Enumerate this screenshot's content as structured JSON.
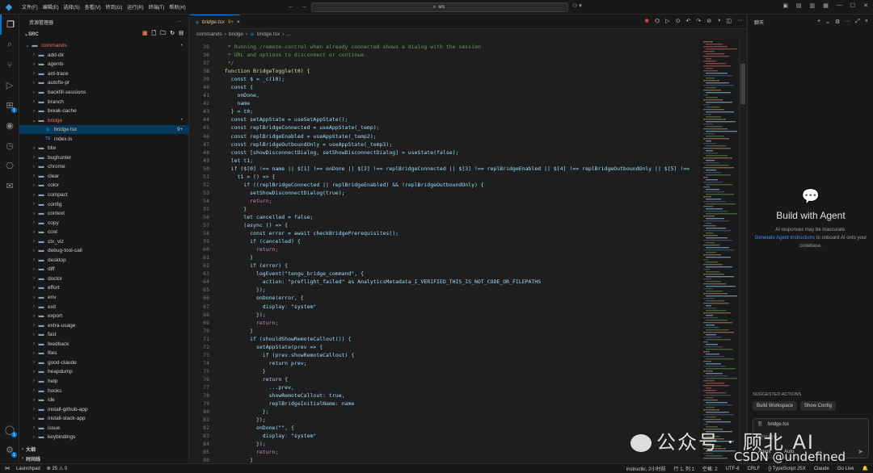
{
  "titlebar": {
    "menu": [
      "文件(F)",
      "编辑(E)",
      "选择(S)",
      "查看(V)",
      "转到(G)",
      "运行(R)",
      "终端(T)",
      "帮助(H)"
    ],
    "search": "src"
  },
  "sidebar": {
    "header": "资源管理器",
    "root": "SRC",
    "items": [
      {
        "label": "commands",
        "type": "folder",
        "open": true,
        "depth": 0,
        "color": "#e2725b",
        "badge": "•"
      },
      {
        "label": "add-dir",
        "type": "folder",
        "depth": 1
      },
      {
        "label": "agents",
        "type": "folder",
        "depth": 1
      },
      {
        "label": "ant-trace",
        "type": "folder",
        "depth": 1
      },
      {
        "label": "autofix-pr",
        "type": "folder",
        "depth": 1
      },
      {
        "label": "backfill-sessions",
        "type": "folder",
        "depth": 1
      },
      {
        "label": "branch",
        "type": "folder",
        "depth": 1
      },
      {
        "label": "break-cache",
        "type": "folder",
        "depth": 1
      },
      {
        "label": "bridge",
        "type": "folder",
        "open": true,
        "depth": 1,
        "color": "#e2725b",
        "badge": "•"
      },
      {
        "label": "bridge.tsx",
        "type": "tsx",
        "depth": 2,
        "selected": true,
        "color": "#e2c08d",
        "badge": "9+"
      },
      {
        "label": "index.ts",
        "type": "ts",
        "depth": 2
      },
      {
        "label": "btw",
        "type": "folder",
        "depth": 1
      },
      {
        "label": "bughunter",
        "type": "folder",
        "depth": 1
      },
      {
        "label": "chrome",
        "type": "folder",
        "depth": 1
      },
      {
        "label": "clear",
        "type": "folder",
        "depth": 1
      },
      {
        "label": "color",
        "type": "folder",
        "depth": 1
      },
      {
        "label": "compact",
        "type": "folder",
        "depth": 1
      },
      {
        "label": "config",
        "type": "folder",
        "depth": 1
      },
      {
        "label": "context",
        "type": "folder",
        "depth": 1
      },
      {
        "label": "copy",
        "type": "folder",
        "depth": 1
      },
      {
        "label": "cost",
        "type": "folder",
        "depth": 1
      },
      {
        "label": "ctx_viz",
        "type": "folder",
        "depth": 1
      },
      {
        "label": "debug-tool-call",
        "type": "folder",
        "depth": 1
      },
      {
        "label": "desktop",
        "type": "folder",
        "depth": 1
      },
      {
        "label": "diff",
        "type": "folder",
        "depth": 1
      },
      {
        "label": "doctor",
        "type": "folder",
        "depth": 1
      },
      {
        "label": "effort",
        "type": "folder",
        "depth": 1
      },
      {
        "label": "env",
        "type": "folder",
        "depth": 1
      },
      {
        "label": "exit",
        "type": "folder",
        "depth": 1
      },
      {
        "label": "export",
        "type": "folder",
        "depth": 1
      },
      {
        "label": "extra-usage",
        "type": "folder",
        "depth": 1
      },
      {
        "label": "fast",
        "type": "folder",
        "depth": 1
      },
      {
        "label": "feedback",
        "type": "folder",
        "depth": 1
      },
      {
        "label": "files",
        "type": "folder",
        "depth": 1
      },
      {
        "label": "good-claude",
        "type": "folder",
        "depth": 1
      },
      {
        "label": "heapdump",
        "type": "folder",
        "depth": 1
      },
      {
        "label": "help",
        "type": "folder",
        "depth": 1
      },
      {
        "label": "hooks",
        "type": "folder",
        "depth": 1
      },
      {
        "label": "ide",
        "type": "folder",
        "depth": 1
      },
      {
        "label": "install-github-app",
        "type": "folder",
        "depth": 1
      },
      {
        "label": "install-slack-app",
        "type": "folder",
        "depth": 1
      },
      {
        "label": "issue",
        "type": "folder",
        "depth": 1
      },
      {
        "label": "keybindings",
        "type": "folder",
        "depth": 1
      }
    ],
    "outline": "大纲",
    "timeline": "时间线"
  },
  "editor": {
    "tab": {
      "label": "bridge.tsx",
      "count": "9+"
    },
    "breadcrumb": [
      "commands",
      "bridge",
      "bridge.tsx",
      "..."
    ],
    "lines": [
      {
        "n": "35",
        "text": "   * Running /remote-control when already connected shows a dialog with the session",
        "cls": "cm"
      },
      {
        "n": "36",
        "text": "   * URL and options to disconnect or continue.",
        "cls": "cm"
      },
      {
        "n": "37",
        "text": "   */",
        "cls": "cm"
      },
      {
        "n": "38",
        "text": "  function BridgeToggle(t0) {",
        "cls": "fnline"
      },
      {
        "n": "39",
        "text": "    const $ = _c(10);",
        "cls": ""
      },
      {
        "n": "40",
        "text": "    const {",
        "cls": ""
      },
      {
        "n": "41",
        "text": "      onDone,",
        "cls": "var"
      },
      {
        "n": "42",
        "text": "      name",
        "cls": "var"
      },
      {
        "n": "43",
        "text": "    } = t0;",
        "cls": ""
      },
      {
        "n": "44",
        "text": "    const setAppState = useSetAppState();",
        "cls": ""
      },
      {
        "n": "45",
        "text": "    const replBridgeConnected = useAppState(_temp);",
        "cls": ""
      },
      {
        "n": "46",
        "text": "    const replBridgeEnabled = useAppState(_temp2);",
        "cls": ""
      },
      {
        "n": "47",
        "text": "    const replBridgeOutboundOnly = useAppState(_temp3);",
        "cls": ""
      },
      {
        "n": "48",
        "text": "    const [showDisconnectDialog, setShowDisconnectDialog] = useState(false);",
        "cls": ""
      },
      {
        "n": "49",
        "text": "    let t1;",
        "cls": ""
      },
      {
        "n": "50",
        "text": "    if ($[0] !== name || $[1] !== onDone || $[2] !== replBridgeConnected || $[3] !== replBridgeEnabled || $[4] !== replBridgeOutboundOnly || $[5] !==",
        "cls": ""
      },
      {
        "n": "51",
        "text": "      t1 = () => {",
        "cls": ""
      },
      {
        "n": "52",
        "text": "        if ((replBridgeConnected || replBridgeEnabled) && !replBridgeOutboundOnly) {",
        "cls": ""
      },
      {
        "n": "53",
        "text": "          setShowDisconnectDialog(true);",
        "cls": ""
      },
      {
        "n": "54",
        "text": "          return;",
        "cls": "kw2"
      },
      {
        "n": "55",
        "text": "        }",
        "cls": ""
      },
      {
        "n": "56",
        "text": "        let cancelled = false;",
        "cls": ""
      },
      {
        "n": "57",
        "text": "        (async () => {",
        "cls": ""
      },
      {
        "n": "58",
        "text": "          const error = await checkBridgePrerequisites();",
        "cls": ""
      },
      {
        "n": "59",
        "text": "          if (cancelled) {",
        "cls": ""
      },
      {
        "n": "60",
        "text": "            return;",
        "cls": "kw2"
      },
      {
        "n": "61",
        "text": "          }",
        "cls": ""
      },
      {
        "n": "62",
        "text": "          if (error) {",
        "cls": ""
      },
      {
        "n": "63",
        "text": "            logEvent(\"tengu_bridge_command\", {",
        "cls": ""
      },
      {
        "n": "64",
        "text": "              action: \"preflight_failed\" as AnalyticsMetadata_I_VERIFIED_THIS_IS_NOT_CODE_OR_FILEPATHS",
        "cls": ""
      },
      {
        "n": "65",
        "text": "            });",
        "cls": ""
      },
      {
        "n": "66",
        "text": "            onDone(error, {",
        "cls": ""
      },
      {
        "n": "67",
        "text": "              display: \"system\"",
        "cls": ""
      },
      {
        "n": "68",
        "text": "            });",
        "cls": ""
      },
      {
        "n": "69",
        "text": "            return;",
        "cls": "kw2"
      },
      {
        "n": "70",
        "text": "          }",
        "cls": ""
      },
      {
        "n": "71",
        "text": "          if (shouldShowRemoteCallout()) {",
        "cls": ""
      },
      {
        "n": "72",
        "text": "            setAppState(prev => {",
        "cls": ""
      },
      {
        "n": "73",
        "text": "              if (prev.showRemoteCallout) {",
        "cls": ""
      },
      {
        "n": "74",
        "text": "                return prev;",
        "cls": ""
      },
      {
        "n": "75",
        "text": "              }",
        "cls": ""
      },
      {
        "n": "76",
        "text": "              return {",
        "cls": ""
      },
      {
        "n": "77",
        "text": "                ...prev,",
        "cls": ""
      },
      {
        "n": "78",
        "text": "                showRemoteCallout: true,",
        "cls": ""
      },
      {
        "n": "79",
        "text": "                replBridgeInitialName: name",
        "cls": ""
      },
      {
        "n": "80",
        "text": "              };",
        "cls": ""
      },
      {
        "n": "81",
        "text": "            });",
        "cls": ""
      },
      {
        "n": "82",
        "text": "            onDone(\"\", {",
        "cls": ""
      },
      {
        "n": "83",
        "text": "              display: \"system\"",
        "cls": ""
      },
      {
        "n": "84",
        "text": "            });",
        "cls": ""
      },
      {
        "n": "85",
        "text": "            return;",
        "cls": "kw2"
      },
      {
        "n": "86",
        "text": "          }",
        "cls": ""
      }
    ]
  },
  "chat": {
    "header": "聊天",
    "title": "Build with Agent",
    "sub1": "AI responses may be inaccurate.",
    "link": "Generate Agent Instructions",
    "sub2": "to onboard AI onto your codebase.",
    "suggested_title": "SUGGESTED ACTIONS",
    "suggestions": [
      "Build Workspace",
      "Show Config"
    ],
    "input_context": "bridge.tsx",
    "input_placeholder": "提供指令",
    "mode": "Agent",
    "model": "Auto"
  },
  "statusbar": {
    "left": [
      "Launchpad",
      "⊗ 25 ⚠ 0"
    ],
    "right": [
      "instructkr, 2小时前",
      "行 1, 列 1",
      "空格: 2",
      "UTF-8",
      "CRLF",
      "{} TypeScript JSX",
      "Claude",
      "Go Live"
    ]
  },
  "watermark": {
    "line1": "公众号 · 顾北 AI",
    "line2": "CSDN @undefined"
  },
  "colors": {
    "accent": "#0078d4",
    "modified": "#e2725b",
    "warning": "#e2c08d"
  }
}
